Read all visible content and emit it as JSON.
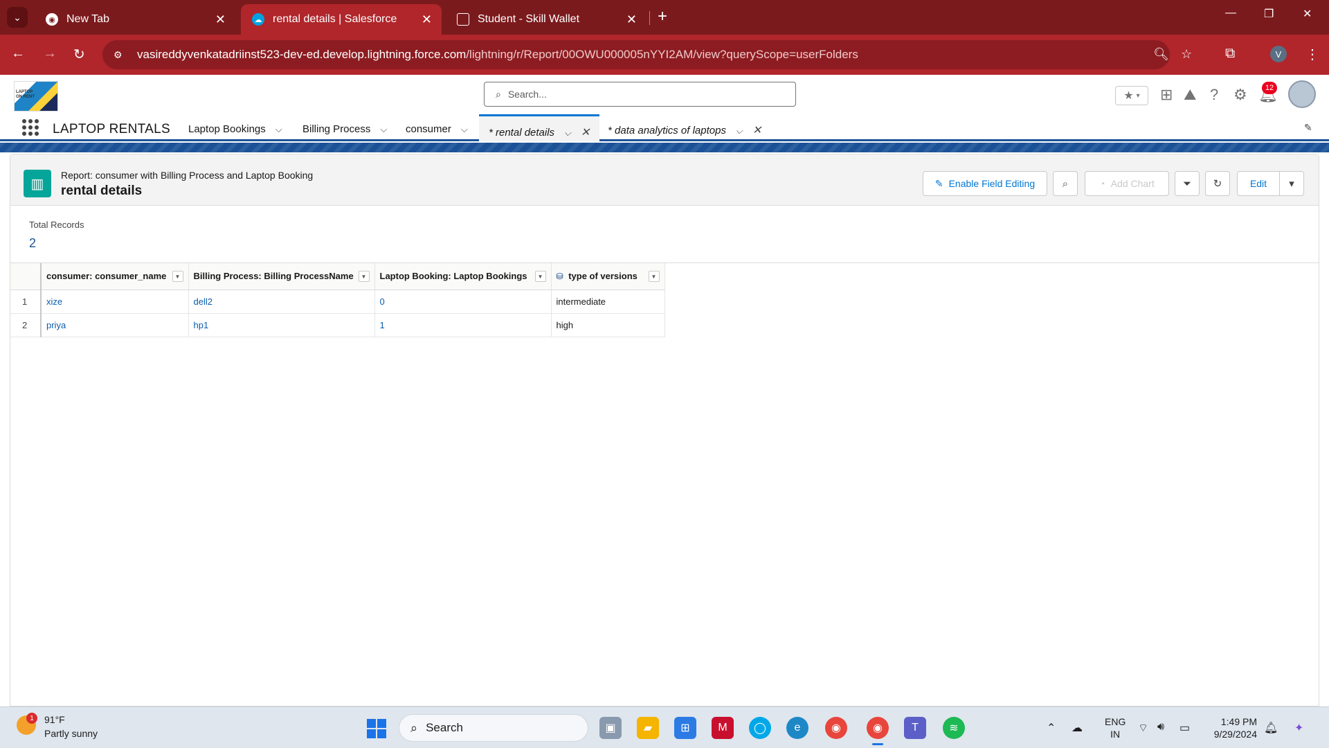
{
  "browser": {
    "tabs": [
      {
        "title": "New Tab",
        "active": false
      },
      {
        "title": "rental details | Salesforce",
        "active": true
      },
      {
        "title": "Student - Skill Wallet",
        "active": false
      }
    ],
    "url_host": "vasireddyvenkatadriinst523-dev-ed.develop.lightning.force.com",
    "url_path": "/lightning/r/Report/00OWU000005nYYI2AM/view?queryScope=userFolders",
    "profile_initial": "V"
  },
  "salesforce": {
    "search_placeholder": "Search...",
    "notification_count": "12",
    "app_name": "LAPTOP RENTALS",
    "nav": {
      "laptop_bookings": "Laptop Bookings",
      "billing_process": "Billing Process",
      "consumer": "consumer",
      "rental_details": "* rental details",
      "data_analytics": "* data analytics of laptops"
    }
  },
  "report": {
    "subtitle": "Report: consumer with Billing Process and Laptop Booking",
    "title": "rental details",
    "buttons": {
      "enable_field_editing": "Enable Field Editing",
      "add_chart": "Add Chart",
      "edit": "Edit"
    },
    "total_records_label": "Total Records",
    "total_records_value": "2",
    "columns": [
      "consumer: consumer_name",
      "Billing Process: Billing ProcessName",
      "Laptop Booking: Laptop Bookings",
      "type of versions"
    ],
    "rows": [
      {
        "num": "1",
        "consumer_name": "xize",
        "billing_process": "dell2",
        "laptop_bookings": "0",
        "type_of_versions": "intermediate"
      },
      {
        "num": "2",
        "consumer_name": "priya",
        "billing_process": "hp1",
        "laptop_bookings": "1",
        "type_of_versions": "high"
      }
    ]
  },
  "taskbar": {
    "weather_temp": "91°F",
    "weather_desc": "Partly sunny",
    "weather_badge": "1",
    "search_label": "Search",
    "lang_line1": "ENG",
    "lang_line2": "IN",
    "time": "1:49 PM",
    "date": "9/29/2024"
  },
  "colors": {
    "chrome_frame": "#7b1a1d",
    "chrome_active": "#b0262b",
    "sf_brand": "#1b5297",
    "link": "#0b5cab",
    "report_icon": "#06a59a"
  }
}
